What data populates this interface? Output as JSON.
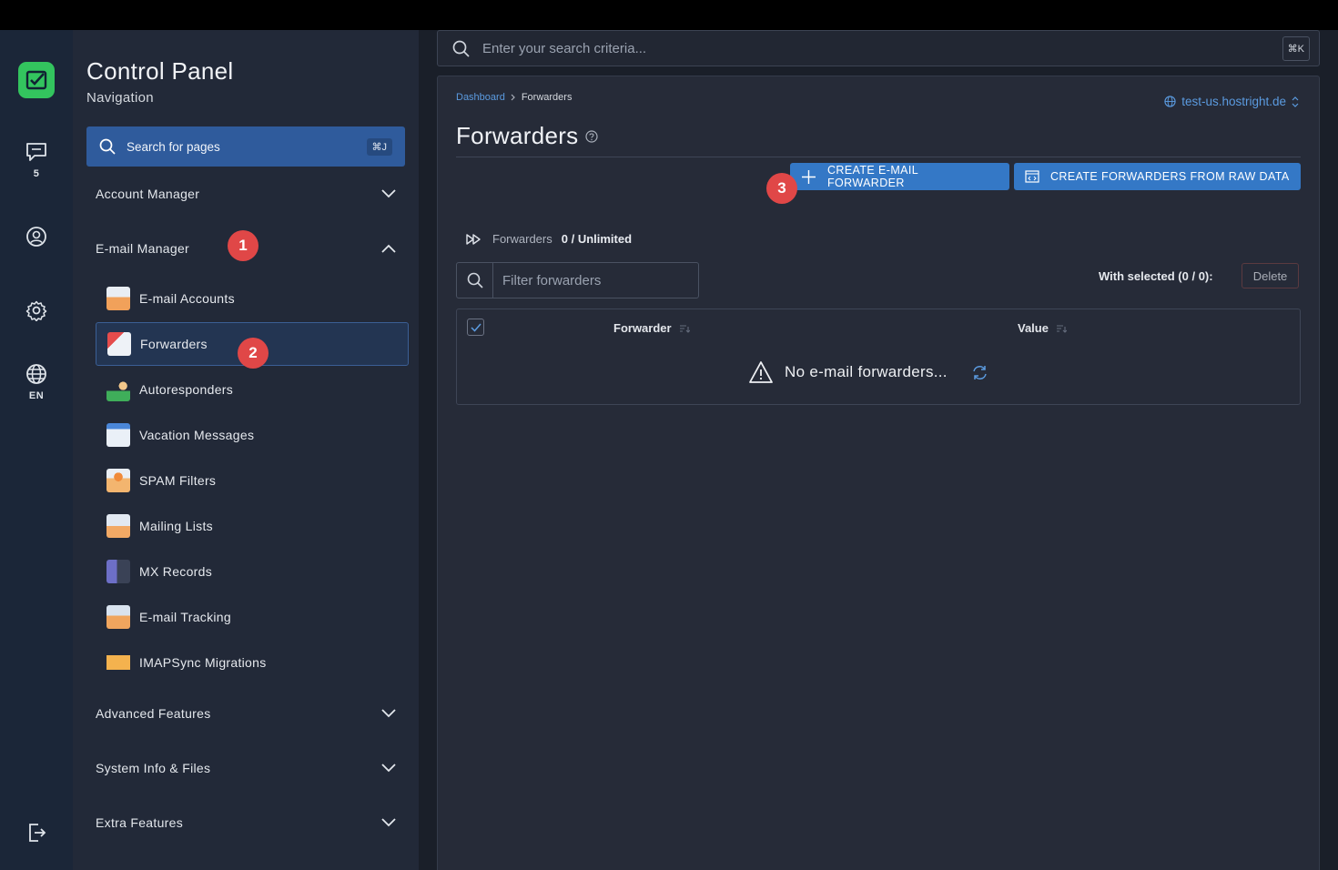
{
  "rail": {
    "messages_count": "5",
    "language": "EN"
  },
  "sidebar": {
    "title": "Control Panel",
    "subtitle": "Navigation",
    "search_label": "Search for pages",
    "search_shortcut": "⌘J",
    "sections": {
      "account_manager": "Account Manager",
      "email_manager": "E-mail Manager",
      "advanced_features": "Advanced Features",
      "system_info": "System Info & Files",
      "extra_features": "Extra Features"
    },
    "email_items": [
      {
        "label": "E-mail Accounts",
        "icon": "email-accounts-icon"
      },
      {
        "label": "Forwarders",
        "icon": "forwarders-icon"
      },
      {
        "label": "Autoresponders",
        "icon": "autoresponders-icon"
      },
      {
        "label": "Vacation Messages",
        "icon": "vacation-messages-icon"
      },
      {
        "label": "SPAM Filters",
        "icon": "spam-filters-icon"
      },
      {
        "label": "Mailing Lists",
        "icon": "mailing-lists-icon"
      },
      {
        "label": "MX Records",
        "icon": "mx-records-icon"
      },
      {
        "label": "E-mail Tracking",
        "icon": "email-tracking-icon"
      },
      {
        "label": "IMAPSync Migrations",
        "icon": "imapsync-icon"
      }
    ]
  },
  "annotations": {
    "badge1": "1",
    "badge2": "2",
    "badge3": "3"
  },
  "global_search": {
    "placeholder": "Enter your search criteria...",
    "shortcut": "⌘K"
  },
  "page": {
    "breadcrumb_home": "Dashboard",
    "breadcrumb_current": "Forwarders",
    "domain": "test-us.hostright.de",
    "title": "Forwarders",
    "create_button": "CREATE E-MAIL FORWARDER",
    "raw_button": "CREATE FORWARDERS FROM RAW DATA",
    "stat_label": "Forwarders",
    "stat_value": "0 / Unlimited",
    "filter_placeholder": "Filter forwarders",
    "with_selected": "With selected (0 / 0):",
    "delete_label": "Delete",
    "col_forwarder": "Forwarder",
    "col_value": "Value",
    "empty_message": "No e-mail forwarders..."
  },
  "colors": {
    "accent": "#3478c6",
    "badge": "#e04747",
    "logo": "#33c45e",
    "link": "#5b9be0"
  }
}
